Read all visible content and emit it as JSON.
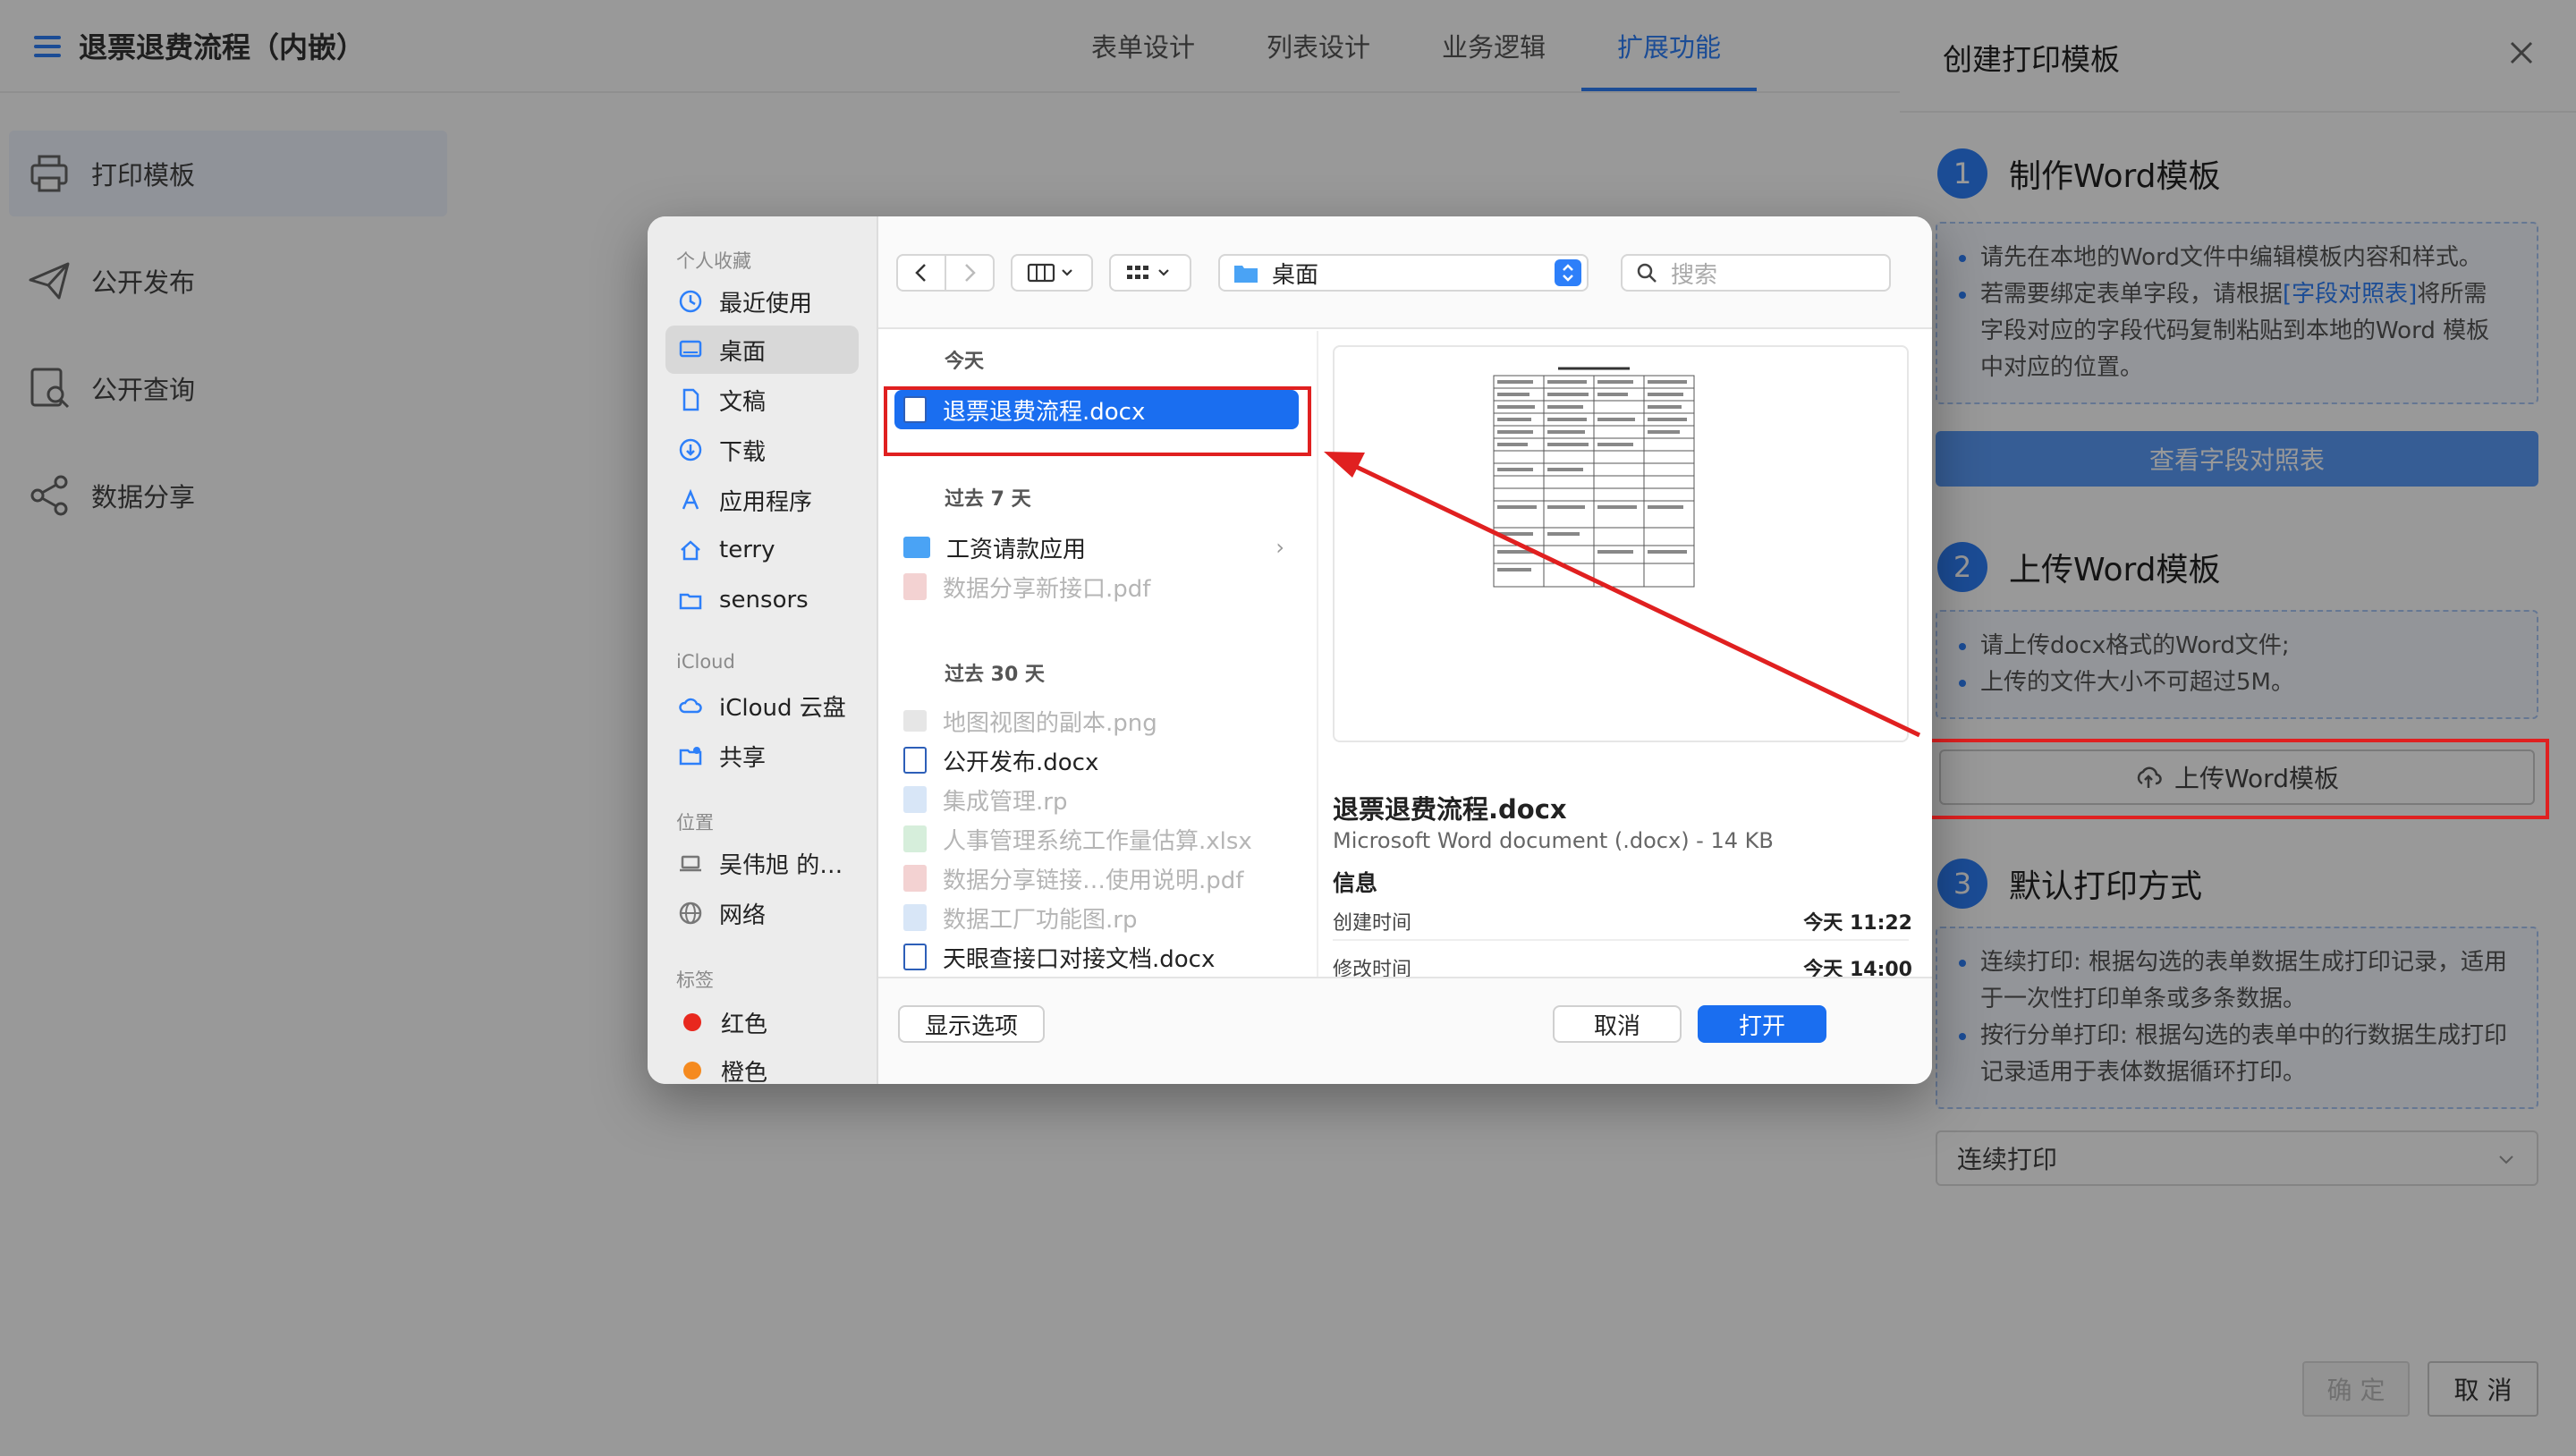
{
  "app": {
    "title": "退票退费流程（内嵌）",
    "tabs": [
      {
        "label": "表单设计",
        "active": false
      },
      {
        "label": "列表设计",
        "active": false
      },
      {
        "label": "业务逻辑",
        "active": false
      },
      {
        "label": "扩展功能",
        "active": true
      }
    ],
    "sidebar": [
      {
        "label": "打印模板",
        "icon": "printer-icon",
        "active": true
      },
      {
        "label": "公开发布",
        "icon": "paper-plane-icon",
        "active": false
      },
      {
        "label": "公开查询",
        "icon": "search-document-icon",
        "active": false
      },
      {
        "label": "数据分享",
        "icon": "share-icon",
        "active": false
      }
    ]
  },
  "drawer": {
    "title": "创建打印模板",
    "steps": [
      {
        "num": "1",
        "title": "制作Word模板"
      },
      {
        "num": "2",
        "title": "上传Word模板"
      },
      {
        "num": "3",
        "title": "默认打印方式"
      }
    ],
    "step1_notes": {
      "line1": "请先在本地的Word文件中编辑模板内容和样式。",
      "line2_pre": "若需要绑定表单字段，请根据",
      "line2_link": "[字段对照表]",
      "line2_post": "将所需字段对应的字段代码复制粘贴到本地的Word 模板中对应的位置。"
    },
    "view_fields_button": "查看字段对照表",
    "step2_notes": [
      "请上传docx格式的Word文件;",
      "上传的文件大小不可超过5M。"
    ],
    "upload_button": "上传Word模板",
    "step3_notes": [
      "连续打印: 根据勾选的表单数据生成打印记录，适用于一次性打印单条或多条数据。",
      "按行分单打印: 根据勾选的表单中的行数据生成打印记录适用于表体数据循环打印。"
    ],
    "print_mode": "连续打印",
    "ok_button": "确 定",
    "cancel_button": "取 消"
  },
  "dialog": {
    "sidebar": {
      "favorites_label": "个人收藏",
      "favorites": [
        {
          "label": "最近使用",
          "icon": "clock-icon",
          "selected": false
        },
        {
          "label": "桌面",
          "icon": "desktop-icon",
          "selected": true
        },
        {
          "label": "文稿",
          "icon": "document-icon",
          "selected": false
        },
        {
          "label": "下载",
          "icon": "download-icon",
          "selected": false
        },
        {
          "label": "应用程序",
          "icon": "applications-icon",
          "selected": false
        },
        {
          "label": "terry",
          "icon": "home-icon",
          "selected": false
        },
        {
          "label": "sensors",
          "icon": "folder-icon",
          "selected": false
        }
      ],
      "icloud_label": "iCloud",
      "icloud": [
        {
          "label": "iCloud 云盘",
          "icon": "cloud-icon"
        },
        {
          "label": "共享",
          "icon": "shared-folder-icon"
        }
      ],
      "locations_label": "位置",
      "locations": [
        {
          "label": "吴伟旭 的…",
          "icon": "laptop-icon"
        },
        {
          "label": "网络",
          "icon": "globe-icon"
        }
      ],
      "tags_label": "标签",
      "tags": [
        {
          "label": "红色",
          "color": "#e8281e"
        },
        {
          "label": "橙色",
          "color": "#f58a1f"
        }
      ]
    },
    "location": "桌面",
    "search_placeholder": "搜索",
    "groups": [
      {
        "label": "今天",
        "files": [
          {
            "name": "退票退费流程.docx",
            "type": "word",
            "dim": false,
            "selected": true
          }
        ]
      },
      {
        "label": "过去 7 天",
        "files": [
          {
            "name": "工资请款应用",
            "type": "folder",
            "dim": false,
            "selected": false,
            "arrow": "›"
          },
          {
            "name": "数据分享新接口.pdf",
            "type": "pdf",
            "dim": true,
            "selected": false
          }
        ]
      },
      {
        "label": "过去 30 天",
        "files": [
          {
            "name": "地图视图的副本.png",
            "type": "png",
            "dim": true,
            "selected": false
          },
          {
            "name": "公开发布.docx",
            "type": "word",
            "dim": false,
            "selected": false
          },
          {
            "name": "集成管理.rp",
            "type": "rp",
            "dim": true,
            "selected": false
          },
          {
            "name": "人事管理系统工作量估算.xlsx",
            "type": "xlsx",
            "dim": true,
            "selected": false
          },
          {
            "name": "数据分享链接…使用说明.pdf",
            "type": "pdf",
            "dim": true,
            "selected": false
          },
          {
            "name": "数据工厂功能图.rp",
            "type": "rp",
            "dim": true,
            "selected": false
          },
          {
            "name": "天眼查接口对接文档.docx",
            "type": "word",
            "dim": false,
            "selected": false
          }
        ]
      }
    ],
    "preview": {
      "name": "退票退费流程.docx",
      "kind": "Microsoft Word document (.docx) - 14 KB",
      "info_label": "信息",
      "created_label": "创建时间",
      "created_value": "今天 11:22",
      "modified_label": "修改时间",
      "modified_value": "今天 14:00"
    },
    "options_button": "显示选项",
    "cancel_button": "取消",
    "open_button": "打开"
  },
  "colors": {
    "accent": "#2d7ff9",
    "selection": "#1a6ef0",
    "annotation": "#e02020"
  }
}
